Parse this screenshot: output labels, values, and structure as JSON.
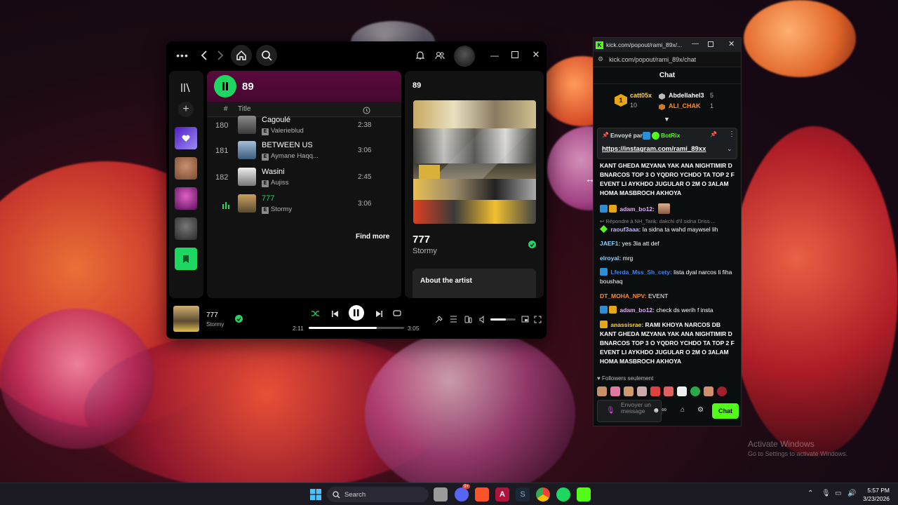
{
  "spotify": {
    "header": {
      "playlist_title": "89"
    },
    "columns": {
      "hash": "#",
      "title": "Title"
    },
    "tracks": [
      {
        "num": "180",
        "title": "Cagoulé",
        "artist": "Valerieblud",
        "duration": "2:38"
      },
      {
        "num": "181",
        "title": "BETWEEN US",
        "artist": "Aymane Haqq...",
        "duration": "3:06"
      },
      {
        "num": "182",
        "title": "Wasini",
        "artist": "Aujiss",
        "duration": "2:45"
      },
      {
        "num": "",
        "title": "777",
        "artist": "Stormy",
        "duration": "3:06"
      }
    ],
    "explicit": "E",
    "find_more": "Find more",
    "right_panel": {
      "title": "89",
      "song": "777",
      "artist": "Stormy",
      "about_label": "About the artist"
    },
    "player": {
      "song": "777",
      "artist": "Stormy",
      "elapsed": "2:11",
      "total": "3:05",
      "progress": 0.71,
      "volume": 0.6
    },
    "colors": {
      "accent": "#1ed760",
      "header": "#5a0a3e"
    }
  },
  "kick": {
    "window_title": "kick.com/popout/rami_89x/...",
    "url": "kick.com/popout/rami_89x/chat",
    "chat_header": "Chat",
    "leaderboard": [
      {
        "name": "catt05x",
        "count": "10"
      },
      {
        "name": "Abdellahel3",
        "count": "5"
      },
      {
        "name": "ALI_CHAK",
        "count": "1"
      }
    ],
    "pinned": {
      "label": "Envoyé par",
      "user": "BotRix",
      "link": "https://instagram.com/rami_89xx"
    },
    "messages": [
      {
        "user": "",
        "text": "KANT GHEDA MZYANA YAK ANA NIGHTIMIR D BNARCOS TOP 3 O YQDRO YCHDO TA TOP 2 F EVENT LI AYKHDO JUGULAR O 2M O 3ALAM HOMA MASBROCH AKHOYA",
        "color": "#fff"
      },
      {
        "user": "adam_bo12:",
        "text": "",
        "color": "#e5a9ff"
      },
      {
        "user": "raouf3aaa:",
        "text": "la sidna ta wahd maywsel lih",
        "color": "#c8b3ff"
      },
      {
        "user": "JAEF1:",
        "text": "yes 3la att def",
        "color": "#8fd1ff"
      },
      {
        "user": "elroyal:",
        "text": "mrg",
        "color": "#8fd1ff"
      },
      {
        "user": "Lferda_Mss_Sh_cety:",
        "text": "lista dyal narcos li fiha boushaq",
        "color": "#3b82ff"
      },
      {
        "user": "DT_MOHA_NPV:",
        "text": "EVENT",
        "color": "#ff8a2a"
      },
      {
        "user": "adam_bo12:",
        "text": "check ds werih f insta",
        "color": "#e5a9ff"
      },
      {
        "user": "anassisrae:",
        "text": "RAMI KHOYA NARCOS DB KANT GHEDA MZYANA YAK ANA NIGHTIMIR D BNARCOS TOP 3 O YQDRO YCHDO TA TOP 2 F EVENT LI AYKHDO JUGULAR O 2M O 3ALAM HOMA MASBROCH AKHOYA",
        "color": "#ffd23a"
      }
    ],
    "reply_hint": "Répondre à NH_Tarik: dakchi d'il sidna Driss ...",
    "followers_only": "Followers seulement",
    "input_placeholder": "Envoyer un message",
    "send_label": "Chat"
  },
  "taskbar": {
    "search_placeholder": "Search",
    "time": "5:57 PM",
    "date": "3/23/2026",
    "badge_count": "9+"
  },
  "watermark": {
    "line1": "Activate Windows",
    "line2": "Go to Settings to activate Windows."
  }
}
